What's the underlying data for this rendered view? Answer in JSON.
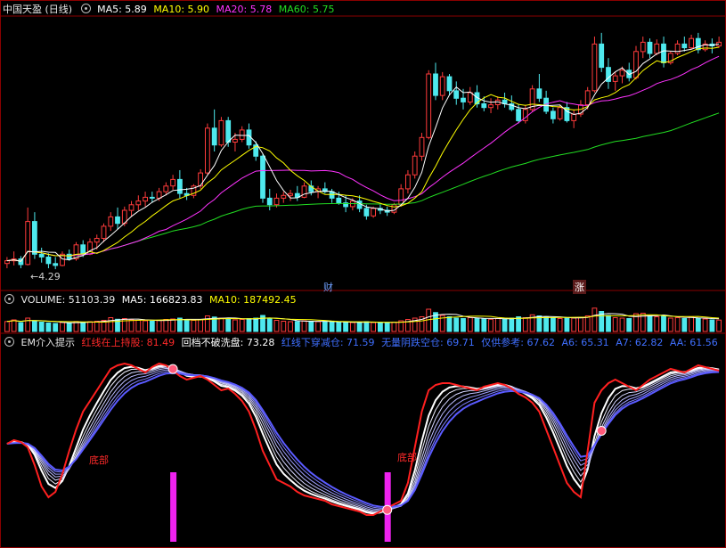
{
  "price_panel": {
    "title": "中国天盈 (日线)",
    "ma5_label": "MA5: 5.89",
    "ma10_label": "MA10: 5.90",
    "ma20_label": "MA20: 5.78",
    "ma60_label": "MA60: 5.75",
    "low_marker": "4.29",
    "event_tag_1": "财",
    "event_tag_2": "涨"
  },
  "volume_panel": {
    "title": "VOLUME: 51103.39",
    "ma5_label": "MA5: 166823.83",
    "ma10_label": "MA10: 187492.45"
  },
  "indicator_panel": {
    "title": "EM介入提示",
    "items": [
      {
        "text": "红线在上持股: 81.49",
        "color": "#ff2a2a"
      },
      {
        "text": "回档不破洗盘: 73.28",
        "color": "#ffffff"
      },
      {
        "text": "红线下穿减仓: 71.59",
        "color": "#3f6fff"
      },
      {
        "text": "无量阴跌空仓: 69.71",
        "color": "#3f6fff"
      },
      {
        "text": "仅供参考: 67.62",
        "color": "#3f6fff"
      },
      {
        "text": "A6: 65.31",
        "color": "#3f6fff"
      },
      {
        "text": "A7: 62.82",
        "color": "#3f6fff"
      },
      {
        "text": "AA: 61.56",
        "color": "#3f6fff"
      }
    ],
    "bottom_label_1": "底部",
    "bottom_label_2": "底部"
  },
  "colors": {
    "up": "#ff3b3b",
    "down": "#4ee9ee",
    "ma5": "#ffffff",
    "ma10": "#ffff00",
    "ma20": "#ff33ff",
    "ma60": "#22dd22",
    "signal_bar": "#ee22ee",
    "grid": "#8a0000"
  },
  "chart_data": {
    "type": "candlestick",
    "title": "中国天盈 (日线)",
    "ylabel": "",
    "ylim": [
      4.1,
      7.0
    ],
    "marked_low": 4.29,
    "candles": [
      [
        4.35,
        4.42,
        4.3,
        4.38
      ],
      [
        4.38,
        4.48,
        4.33,
        4.4
      ],
      [
        4.4,
        4.43,
        4.3,
        4.34
      ],
      [
        4.34,
        4.95,
        4.33,
        4.8
      ],
      [
        4.8,
        4.9,
        4.4,
        4.45
      ],
      [
        4.45,
        4.52,
        4.36,
        4.42
      ],
      [
        4.42,
        4.46,
        4.3,
        4.35
      ],
      [
        4.35,
        4.42,
        4.29,
        4.33
      ],
      [
        4.33,
        4.48,
        4.32,
        4.45
      ],
      [
        4.45,
        4.5,
        4.38,
        4.4
      ],
      [
        4.4,
        4.58,
        4.38,
        4.55
      ],
      [
        4.55,
        4.6,
        4.42,
        4.45
      ],
      [
        4.45,
        4.62,
        4.44,
        4.58
      ],
      [
        4.58,
        4.66,
        4.5,
        4.62
      ],
      [
        4.62,
        4.78,
        4.58,
        4.75
      ],
      [
        4.75,
        4.9,
        4.7,
        4.85
      ],
      [
        4.85,
        4.95,
        4.72,
        4.78
      ],
      [
        4.78,
        4.96,
        4.75,
        4.92
      ],
      [
        4.92,
        5.02,
        4.85,
        4.98
      ],
      [
        4.98,
        5.08,
        4.92,
        5.02
      ],
      [
        5.02,
        5.12,
        4.96,
        5.06
      ],
      [
        5.06,
        5.12,
        5.0,
        5.05
      ],
      [
        5.05,
        5.16,
        5.02,
        5.12
      ],
      [
        5.12,
        5.22,
        5.08,
        5.18
      ],
      [
        5.18,
        5.3,
        5.14,
        5.25
      ],
      [
        5.25,
        5.35,
        5.05,
        5.1
      ],
      [
        5.1,
        5.16,
        5.03,
        5.08
      ],
      [
        5.08,
        5.2,
        5.05,
        5.18
      ],
      [
        5.18,
        5.36,
        5.15,
        5.32
      ],
      [
        5.32,
        5.85,
        5.3,
        5.8
      ],
      [
        5.8,
        6.0,
        5.55,
        5.62
      ],
      [
        5.62,
        5.92,
        5.6,
        5.88
      ],
      [
        5.88,
        5.92,
        5.6,
        5.65
      ],
      [
        5.65,
        5.75,
        5.55,
        5.68
      ],
      [
        5.68,
        5.82,
        5.65,
        5.78
      ],
      [
        5.78,
        5.85,
        5.58,
        5.62
      ],
      [
        5.62,
        5.66,
        5.45,
        5.5
      ],
      [
        5.5,
        5.52,
        5.0,
        5.05
      ],
      [
        5.05,
        5.15,
        4.92,
        4.98
      ],
      [
        4.98,
        5.1,
        4.95,
        5.05
      ],
      [
        5.05,
        5.12,
        5.0,
        5.08
      ],
      [
        5.08,
        5.14,
        5.02,
        5.1
      ],
      [
        5.1,
        5.18,
        5.02,
        5.06
      ],
      [
        5.06,
        5.22,
        5.05,
        5.18
      ],
      [
        5.18,
        5.24,
        5.08,
        5.12
      ],
      [
        5.12,
        5.18,
        5.05,
        5.15
      ],
      [
        5.15,
        5.22,
        5.1,
        5.12
      ],
      [
        5.12,
        5.15,
        5.0,
        5.05
      ],
      [
        5.05,
        5.12,
        4.98,
        5.0
      ],
      [
        5.0,
        5.08,
        4.9,
        4.96
      ],
      [
        4.96,
        5.05,
        4.92,
        5.02
      ],
      [
        5.02,
        5.08,
        4.9,
        4.94
      ],
      [
        4.94,
        4.98,
        4.82,
        4.86
      ],
      [
        4.86,
        4.96,
        4.84,
        4.94
      ],
      [
        4.94,
        4.98,
        4.88,
        4.92
      ],
      [
        4.92,
        4.96,
        4.86,
        4.9
      ],
      [
        4.9,
        5.0,
        4.88,
        4.98
      ],
      [
        4.98,
        5.2,
        4.96,
        5.15
      ],
      [
        5.15,
        5.35,
        5.1,
        5.3
      ],
      [
        5.3,
        5.55,
        5.26,
        5.5
      ],
      [
        5.5,
        5.75,
        5.45,
        5.7
      ],
      [
        5.7,
        6.42,
        5.68,
        6.38
      ],
      [
        6.38,
        6.5,
        6.1,
        6.15
      ],
      [
        6.15,
        6.4,
        6.1,
        6.35
      ],
      [
        6.35,
        6.38,
        6.15,
        6.2
      ],
      [
        6.2,
        6.3,
        6.05,
        6.12
      ],
      [
        6.12,
        6.22,
        6.0,
        6.08
      ],
      [
        6.08,
        6.24,
        6.05,
        6.18
      ],
      [
        6.18,
        6.26,
        6.02,
        6.06
      ],
      [
        6.06,
        6.14,
        5.98,
        6.02
      ],
      [
        6.02,
        6.12,
        5.96,
        6.05
      ],
      [
        6.05,
        6.14,
        6.0,
        6.1
      ],
      [
        6.1,
        6.18,
        6.02,
        6.06
      ],
      [
        6.06,
        6.15,
        5.98,
        6.0
      ],
      [
        6.0,
        6.06,
        5.85,
        5.88
      ],
      [
        5.88,
        6.05,
        5.85,
        6.0
      ],
      [
        6.0,
        6.26,
        5.98,
        6.22
      ],
      [
        6.22,
        6.38,
        6.08,
        6.12
      ],
      [
        6.12,
        6.2,
        5.95,
        5.98
      ],
      [
        5.98,
        6.02,
        5.85,
        5.9
      ],
      [
        5.9,
        6.05,
        5.88,
        6.02
      ],
      [
        6.02,
        6.08,
        5.86,
        5.88
      ],
      [
        5.88,
        6.0,
        5.8,
        5.95
      ],
      [
        5.95,
        6.1,
        5.92,
        6.05
      ],
      [
        6.05,
        6.24,
        6.0,
        6.2
      ],
      [
        6.2,
        6.78,
        6.18,
        6.7
      ],
      [
        6.7,
        6.82,
        6.4,
        6.45
      ],
      [
        6.45,
        6.55,
        6.22,
        6.3
      ],
      [
        6.3,
        6.4,
        6.2,
        6.36
      ],
      [
        6.36,
        6.46,
        6.28,
        6.42
      ],
      [
        6.42,
        6.5,
        6.3,
        6.34
      ],
      [
        6.34,
        6.68,
        6.32,
        6.62
      ],
      [
        6.62,
        6.78,
        6.55,
        6.72
      ],
      [
        6.72,
        6.76,
        6.55,
        6.6
      ],
      [
        6.6,
        6.75,
        6.58,
        6.7
      ],
      [
        6.7,
        6.78,
        6.45,
        6.5
      ],
      [
        6.5,
        6.62,
        6.48,
        6.6
      ],
      [
        6.6,
        6.74,
        6.58,
        6.7
      ],
      [
        6.7,
        6.78,
        6.62,
        6.66
      ],
      [
        6.66,
        6.8,
        6.64,
        6.76
      ],
      [
        6.76,
        6.82,
        6.6,
        6.64
      ],
      [
        6.64,
        6.74,
        6.62,
        6.7
      ],
      [
        6.7,
        6.76,
        6.6,
        6.68
      ],
      [
        6.68,
        6.78,
        6.66,
        6.72
      ]
    ],
    "volume_ylim": [
      0,
      120000
    ],
    "volume": [
      45000,
      52000,
      40000,
      60000,
      48000,
      42000,
      38000,
      36000,
      40000,
      38000,
      45000,
      42000,
      44000,
      46000,
      50000,
      62000,
      55000,
      58000,
      52000,
      50000,
      48000,
      46000,
      50000,
      54000,
      56000,
      60000,
      52000,
      50000,
      54000,
      70000,
      65000,
      60000,
      56000,
      52000,
      54000,
      58000,
      60000,
      72000,
      58000,
      50000,
      46000,
      44000,
      45000,
      48000,
      46000,
      44000,
      45000,
      42000,
      40000,
      42000,
      40000,
      42000,
      44000,
      40000,
      38000,
      40000,
      42000,
      48000,
      54000,
      60000,
      66000,
      100000,
      85000,
      72000,
      66000,
      60000,
      58000,
      62000,
      60000,
      56000,
      55000,
      58000,
      56000,
      60000,
      66000,
      62000,
      75000,
      70000,
      64000,
      60000,
      58000,
      62000,
      60000,
      64000,
      70000,
      105000,
      90000,
      72000,
      62000,
      60000,
      58000,
      80000,
      82000,
      70000,
      66000,
      72000,
      60000,
      62000,
      58000,
      64000,
      60000,
      56000,
      52000,
      51103
    ],
    "indicator_ylim": [
      0,
      100
    ],
    "red_line": [
      52,
      54,
      53,
      50,
      40,
      28,
      22,
      25,
      35,
      48,
      60,
      70,
      76,
      82,
      88,
      94,
      96,
      97,
      96,
      94,
      92,
      95,
      97,
      96,
      93,
      90,
      88,
      89,
      90,
      88,
      85,
      82,
      83,
      80,
      76,
      70,
      60,
      48,
      40,
      32,
      30,
      28,
      25,
      23,
      22,
      21,
      20,
      18,
      17,
      16,
      15,
      14,
      12,
      12,
      14,
      16,
      18,
      20,
      30,
      50,
      70,
      82,
      85,
      86,
      86,
      85,
      84,
      83,
      82,
      84,
      85,
      86,
      85,
      83,
      80,
      78,
      75,
      70,
      60,
      50,
      40,
      30,
      25,
      22,
      48,
      75,
      82,
      86,
      88,
      86,
      84,
      82,
      85,
      88,
      90,
      92,
      94,
      93,
      92,
      94,
      96,
      95,
      94,
      93
    ]
  }
}
